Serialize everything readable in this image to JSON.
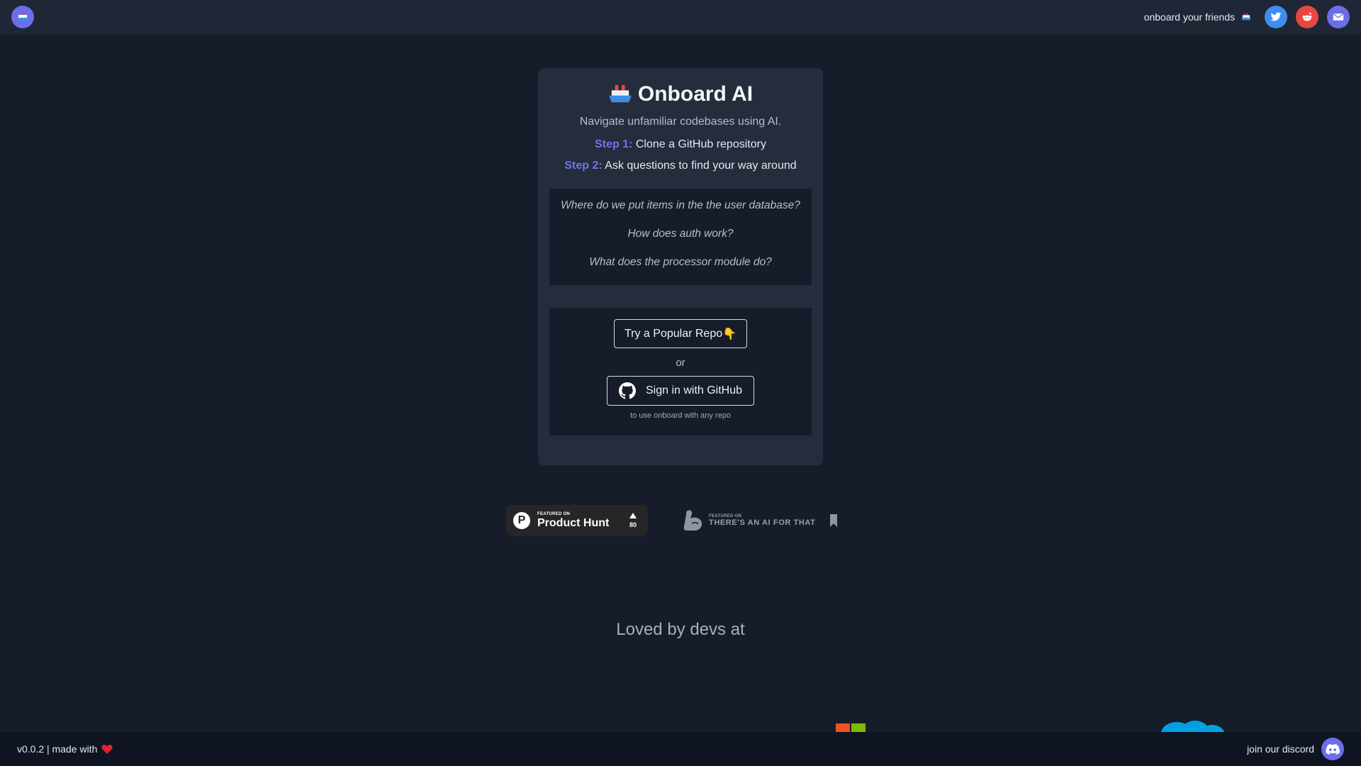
{
  "header": {
    "share_text": "onboard your friends",
    "social_buttons": [
      {
        "name": "twitter",
        "color": "#3d8ef0",
        "icon": "twitter-icon"
      },
      {
        "name": "reddit",
        "color": "#e8473f",
        "icon": "reddit-icon"
      },
      {
        "name": "email",
        "color": "#6b6ee8",
        "icon": "mail-icon"
      }
    ]
  },
  "card": {
    "title": "Onboard AI",
    "subtitle": "Navigate unfamiliar codebases using AI.",
    "step1_label": "Step 1:",
    "step1_text": " Clone a GitHub repository",
    "step2_label": "Step 2:",
    "step2_text": " Ask questions to find your way around",
    "examples": [
      "Where do we put items in the the user database?",
      "How does auth work?",
      "What does the processor module do?"
    ],
    "popular_button": "Try a Popular Repo",
    "popular_emoji": "👇",
    "or_text": "or",
    "github_button": "Sign in with GitHub",
    "github_hint": "to use onboard with any repo"
  },
  "badges": {
    "product_hunt_small": "FEATURED ON",
    "product_hunt_big": "Product Hunt",
    "product_hunt_votes": "80",
    "aift_small": "FEATURED ON",
    "aift_big": "THERE'S AN AI FOR THAT"
  },
  "loved_text": "Loved by devs at",
  "footer": {
    "version_text": "v0.0.2 | made with",
    "discord_text": "join our discord"
  },
  "colors": {
    "background": "#161c2a",
    "card": "#252c3b",
    "accent": "#6f74f0"
  }
}
